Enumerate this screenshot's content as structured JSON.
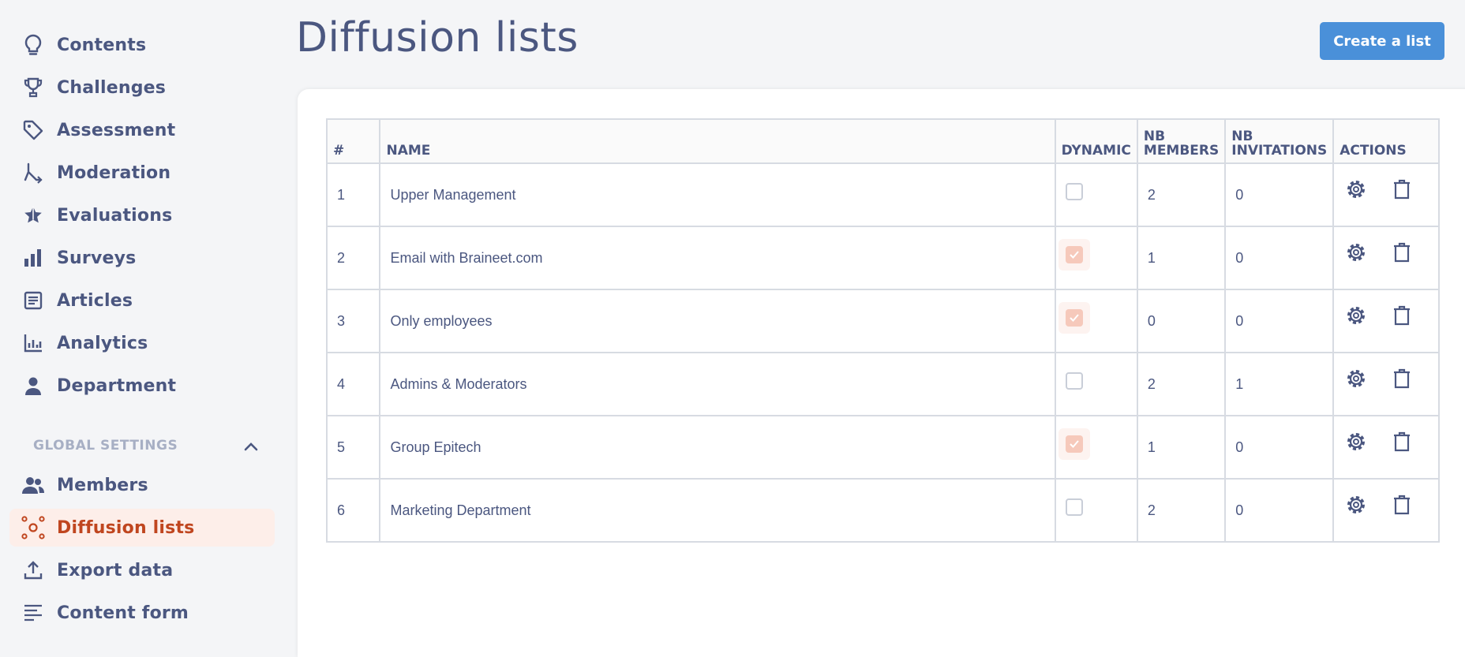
{
  "sidebar": {
    "items": [
      {
        "label": "Contents",
        "icon": "lightbulb-icon"
      },
      {
        "label": "Challenges",
        "icon": "trophy-icon"
      },
      {
        "label": "Assessment",
        "icon": "tag-icon"
      },
      {
        "label": "Moderation",
        "icon": "moderation-icon"
      },
      {
        "label": "Evaluations",
        "icon": "star-icon"
      },
      {
        "label": "Surveys",
        "icon": "bar-chart-icon"
      },
      {
        "label": "Articles",
        "icon": "document-icon"
      },
      {
        "label": "Analytics",
        "icon": "analytics-icon"
      },
      {
        "label": "Department",
        "icon": "person-icon"
      }
    ],
    "section_title": "GLOBAL SETTINGS",
    "settings_items": [
      {
        "label": "Members",
        "icon": "people-icon"
      },
      {
        "label": "Diffusion lists",
        "icon": "network-icon",
        "active": true
      },
      {
        "label": "Export data",
        "icon": "upload-icon"
      },
      {
        "label": "Content form",
        "icon": "lines-icon"
      }
    ]
  },
  "header": {
    "title": "Diffusion lists",
    "create_button": "Create a list"
  },
  "table": {
    "columns": {
      "num": "#",
      "name": "NAME",
      "dynamic": "DYNAMIC",
      "members_1": "NB",
      "members_2": "MEMBERS",
      "invitations_1": "NB",
      "invitations_2": "INVITATIONS",
      "actions": "ACTIONS"
    },
    "rows": [
      {
        "num": "1",
        "name": "Upper Management",
        "dynamic": false,
        "members": "2",
        "invitations": "0"
      },
      {
        "num": "2",
        "name": "Email with Braineet.com",
        "dynamic": true,
        "members": "1",
        "invitations": "0"
      },
      {
        "num": "3",
        "name": "Only employees",
        "dynamic": true,
        "members": "0",
        "invitations": "0"
      },
      {
        "num": "4",
        "name": "Admins & Moderators",
        "dynamic": false,
        "members": "2",
        "invitations": "1"
      },
      {
        "num": "5",
        "name": "Group Epitech",
        "dynamic": true,
        "members": "1",
        "invitations": "0"
      },
      {
        "num": "6",
        "name": "Marketing Department",
        "dynamic": false,
        "members": "2",
        "invitations": "0"
      }
    ]
  },
  "colors": {
    "accent": "#4a90d9",
    "active_text": "#c0461f",
    "active_bg": "#fdeee9",
    "text": "#4b5780"
  }
}
